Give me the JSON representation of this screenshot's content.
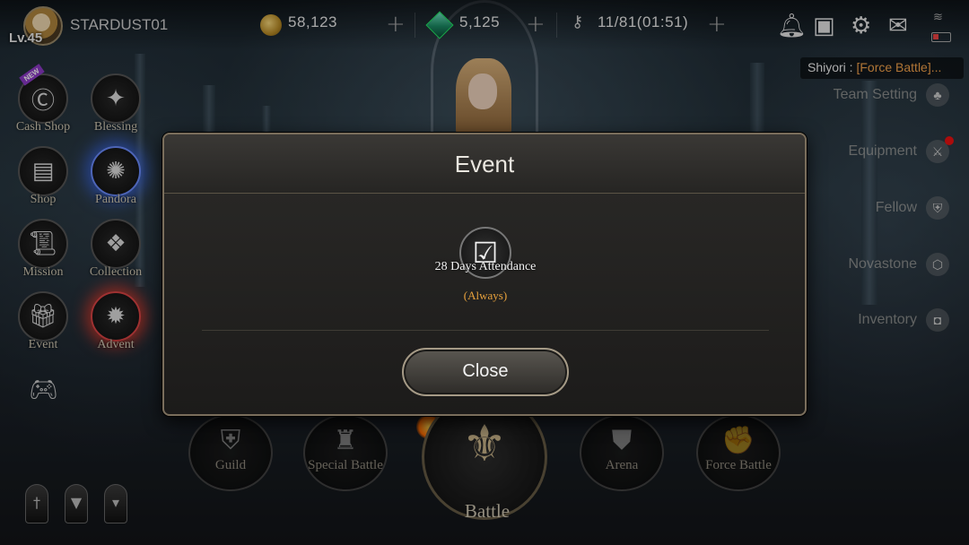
{
  "player": {
    "level": "Lv.45",
    "name": "STARDUST01"
  },
  "resources": {
    "gold": "58,123",
    "gems": "5,125",
    "stamina": "11/81(01:51)",
    "plus": "+"
  },
  "chat": {
    "speaker": "Shiyori : ",
    "message": "[Force Battle]..."
  },
  "left_menu": [
    {
      "label": "Cash Shop",
      "badge": "NEW"
    },
    {
      "label": "Blessing"
    },
    {
      "label": "Shop"
    },
    {
      "label": "Pandora"
    },
    {
      "label": "Mission"
    },
    {
      "label": "Collection"
    },
    {
      "label": "Event"
    },
    {
      "label": "Advent"
    }
  ],
  "right_menu": [
    "Team Setting",
    "Equipment",
    "Fellow",
    "Novastone",
    "Inventory"
  ],
  "battle_menu": [
    "Guild",
    "Special Battle",
    "Battle",
    "Arena",
    "Force Battle"
  ],
  "modal": {
    "title": "Event",
    "event": {
      "name": "28 Days Attendance",
      "sub": "(Always)"
    },
    "close_label": "Close"
  }
}
